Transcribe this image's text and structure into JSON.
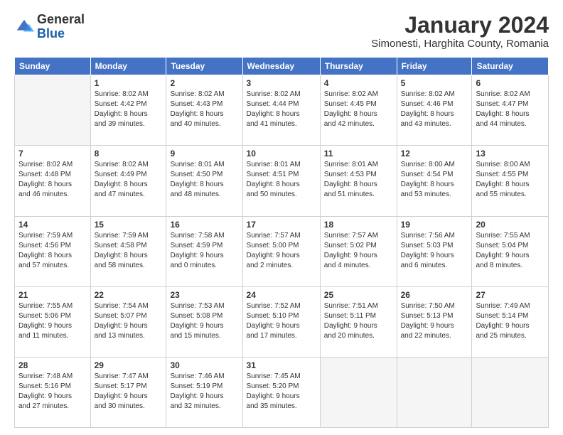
{
  "header": {
    "logo_general": "General",
    "logo_blue": "Blue",
    "title": "January 2024",
    "location": "Simonesti, Harghita County, Romania"
  },
  "weekdays": [
    "Sunday",
    "Monday",
    "Tuesday",
    "Wednesday",
    "Thursday",
    "Friday",
    "Saturday"
  ],
  "weeks": [
    [
      {
        "day": "",
        "empty": true
      },
      {
        "day": "1",
        "sunrise": "8:02 AM",
        "sunset": "4:42 PM",
        "daylight": "8 hours and 39 minutes."
      },
      {
        "day": "2",
        "sunrise": "8:02 AM",
        "sunset": "4:43 PM",
        "daylight": "8 hours and 40 minutes."
      },
      {
        "day": "3",
        "sunrise": "8:02 AM",
        "sunset": "4:44 PM",
        "daylight": "8 hours and 41 minutes."
      },
      {
        "day": "4",
        "sunrise": "8:02 AM",
        "sunset": "4:45 PM",
        "daylight": "8 hours and 42 minutes."
      },
      {
        "day": "5",
        "sunrise": "8:02 AM",
        "sunset": "4:46 PM",
        "daylight": "8 hours and 43 minutes."
      },
      {
        "day": "6",
        "sunrise": "8:02 AM",
        "sunset": "4:47 PM",
        "daylight": "8 hours and 44 minutes."
      }
    ],
    [
      {
        "day": "7",
        "sunrise": "8:02 AM",
        "sunset": "4:48 PM",
        "daylight": "8 hours and 46 minutes."
      },
      {
        "day": "8",
        "sunrise": "8:02 AM",
        "sunset": "4:49 PM",
        "daylight": "8 hours and 47 minutes."
      },
      {
        "day": "9",
        "sunrise": "8:01 AM",
        "sunset": "4:50 PM",
        "daylight": "8 hours and 48 minutes."
      },
      {
        "day": "10",
        "sunrise": "8:01 AM",
        "sunset": "4:51 PM",
        "daylight": "8 hours and 50 minutes."
      },
      {
        "day": "11",
        "sunrise": "8:01 AM",
        "sunset": "4:53 PM",
        "daylight": "8 hours and 51 minutes."
      },
      {
        "day": "12",
        "sunrise": "8:00 AM",
        "sunset": "4:54 PM",
        "daylight": "8 hours and 53 minutes."
      },
      {
        "day": "13",
        "sunrise": "8:00 AM",
        "sunset": "4:55 PM",
        "daylight": "8 hours and 55 minutes."
      }
    ],
    [
      {
        "day": "14",
        "sunrise": "7:59 AM",
        "sunset": "4:56 PM",
        "daylight": "8 hours and 57 minutes."
      },
      {
        "day": "15",
        "sunrise": "7:59 AM",
        "sunset": "4:58 PM",
        "daylight": "8 hours and 58 minutes."
      },
      {
        "day": "16",
        "sunrise": "7:58 AM",
        "sunset": "4:59 PM",
        "daylight": "9 hours and 0 minutes."
      },
      {
        "day": "17",
        "sunrise": "7:57 AM",
        "sunset": "5:00 PM",
        "daylight": "9 hours and 2 minutes."
      },
      {
        "day": "18",
        "sunrise": "7:57 AM",
        "sunset": "5:02 PM",
        "daylight": "9 hours and 4 minutes."
      },
      {
        "day": "19",
        "sunrise": "7:56 AM",
        "sunset": "5:03 PM",
        "daylight": "9 hours and 6 minutes."
      },
      {
        "day": "20",
        "sunrise": "7:55 AM",
        "sunset": "5:04 PM",
        "daylight": "9 hours and 8 minutes."
      }
    ],
    [
      {
        "day": "21",
        "sunrise": "7:55 AM",
        "sunset": "5:06 PM",
        "daylight": "9 hours and 11 minutes."
      },
      {
        "day": "22",
        "sunrise": "7:54 AM",
        "sunset": "5:07 PM",
        "daylight": "9 hours and 13 minutes."
      },
      {
        "day": "23",
        "sunrise": "7:53 AM",
        "sunset": "5:08 PM",
        "daylight": "9 hours and 15 minutes."
      },
      {
        "day": "24",
        "sunrise": "7:52 AM",
        "sunset": "5:10 PM",
        "daylight": "9 hours and 17 minutes."
      },
      {
        "day": "25",
        "sunrise": "7:51 AM",
        "sunset": "5:11 PM",
        "daylight": "9 hours and 20 minutes."
      },
      {
        "day": "26",
        "sunrise": "7:50 AM",
        "sunset": "5:13 PM",
        "daylight": "9 hours and 22 minutes."
      },
      {
        "day": "27",
        "sunrise": "7:49 AM",
        "sunset": "5:14 PM",
        "daylight": "9 hours and 25 minutes."
      }
    ],
    [
      {
        "day": "28",
        "sunrise": "7:48 AM",
        "sunset": "5:16 PM",
        "daylight": "9 hours and 27 minutes."
      },
      {
        "day": "29",
        "sunrise": "7:47 AM",
        "sunset": "5:17 PM",
        "daylight": "9 hours and 30 minutes."
      },
      {
        "day": "30",
        "sunrise": "7:46 AM",
        "sunset": "5:19 PM",
        "daylight": "9 hours and 32 minutes."
      },
      {
        "day": "31",
        "sunrise": "7:45 AM",
        "sunset": "5:20 PM",
        "daylight": "9 hours and 35 minutes."
      },
      {
        "day": "",
        "empty": true
      },
      {
        "day": "",
        "empty": true
      },
      {
        "day": "",
        "empty": true
      }
    ]
  ],
  "labels": {
    "sunrise_prefix": "Sunrise: ",
    "sunset_prefix": "Sunset: ",
    "daylight_prefix": "Daylight: "
  }
}
